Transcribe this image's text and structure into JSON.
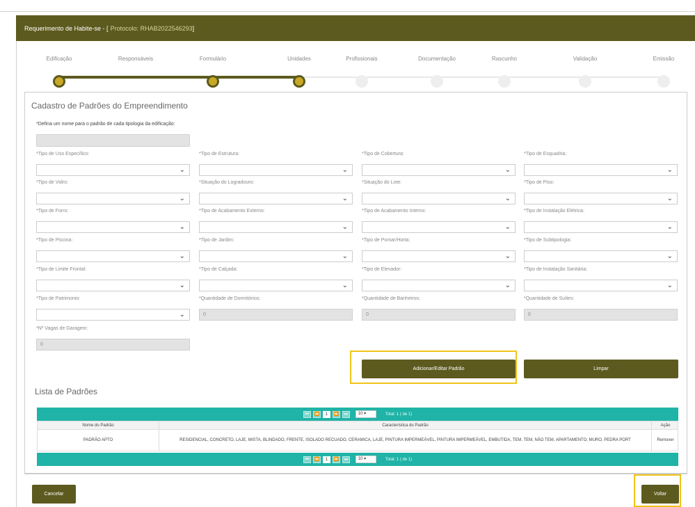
{
  "header": {
    "title": "Requerimento de Habite-se - [",
    "protocol": "Protocolo: RHAB2022546293",
    "close": " ]"
  },
  "steps": [
    {
      "label": "Edificação",
      "done": true
    },
    {
      "label": "Responsáveis",
      "done": false
    },
    {
      "label": "Formulário",
      "done": true
    },
    {
      "label": "Unidades",
      "done": true
    },
    {
      "label": "Profissionais",
      "done": false
    },
    {
      "label": "Documentação",
      "done": false
    },
    {
      "label": "Rascunho",
      "done": false
    },
    {
      "label": "Validação",
      "done": false
    },
    {
      "label": "Emissão",
      "done": false
    }
  ],
  "form": {
    "title": "Cadastro de Padrões do Empreendimento",
    "name_label": "*Defina um nome para o padrão de cada tipologia da edificação:",
    "fields": {
      "uso": "*Tipo de Uso Específico:",
      "estrutura": "*Tipo de Estrutura:",
      "cobertura": "*Tipo de Cobertura:",
      "esquadria": "*Tipo de Esquadria:",
      "vidro": "*Tipo de Vidro:",
      "logradouro": "*Situação do Logradouro:",
      "lote": "*Situação do Lote:",
      "piso": "*Tipo de Piso:",
      "forro": "*Tipo de Forro:",
      "acab_externo": "*Tipo de Acabamento Externo:",
      "acab_interno": "*Tipo de Acabamento Interno:",
      "inst_eletrica": "*Tipo de Instalação Elétrica:",
      "piscina": "*Tipo de Piscina:",
      "jardim": "*Tipo de Jardim:",
      "pomar": "*Tipo de Pomar/Horta:",
      "subtipologia": "*Tipo de Subtipologia:",
      "limite": "*Tipo de Limite Frontal:",
      "calcada": "*Tipo de Calçada:",
      "elevador": "*Tipo de Elevador:",
      "inst_sanitaria": "*Tipo de Instalação Sanitária:",
      "patrimonio": "*Tipo de Patrimonio:",
      "dormitorios": "*Quantidade de Dormitórios:",
      "banheiros": "*Quantidade de Banheiros:",
      "suites": "*Quantidade de Suítes:",
      "vagas": "*Nº Vagas de Garagem:"
    },
    "values": {
      "dormitorios": "0",
      "banheiros": "0",
      "suites": "0",
      "vagas": "0"
    },
    "add_button": "Adicionar/Editar Padrão",
    "clear_button": "Limpar"
  },
  "list": {
    "title": "Lista de Padrões",
    "pager": {
      "first": "⏮",
      "prev": "⏪",
      "page": "1",
      "next": "⏩",
      "last": "⏭",
      "per_page": "10",
      "total": "Total: 1 ( de 1)"
    },
    "columns": [
      "Nome do Padrão",
      "Característica do Padrão",
      "Ação"
    ],
    "rows": [
      {
        "name": "PADRÃO APTO",
        "characteristics": "RESIDENCIAL, CONCRETO, LAJE, MISTA, BLINDADO, FRENTE, ISOLADO RECUADO, CERAMICA, LAJE, PINTURA IMPERMEÁVEL, PINTURA IMPERMEÁVEL, EMBUTIDA, TEM, TEM, NÃO TEM, APARTAMENTO, MURO, PEDRA PORT",
        "action": "Remover"
      }
    ]
  },
  "footer": {
    "cancel_button": "Cancelar",
    "back_button": "Voltar"
  },
  "colors": {
    "primary": "#5d5a1f",
    "step_dot": "#c9a826",
    "pager": "#20b3a7",
    "highlight": "#f0c419"
  }
}
